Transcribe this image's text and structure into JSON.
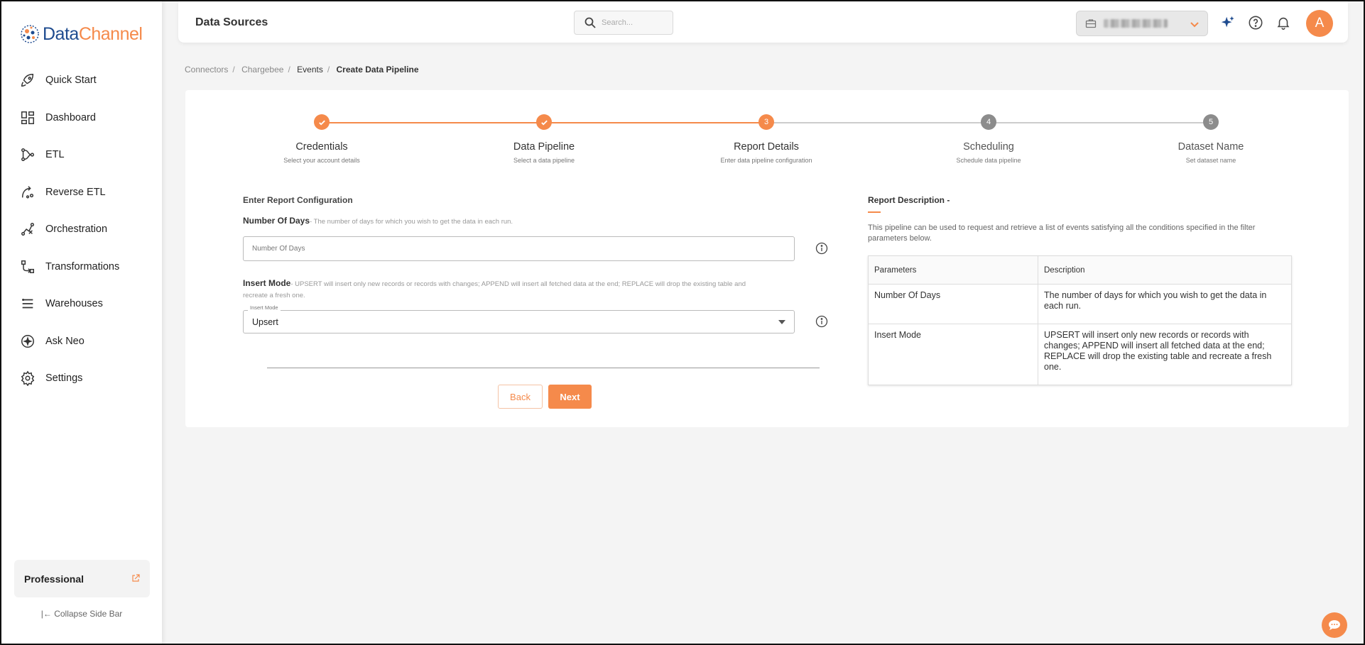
{
  "brand": {
    "name_part1": "Data",
    "name_part2": "Channel"
  },
  "sidebar": {
    "items": [
      {
        "label": "Quick Start",
        "icon": "rocket-icon"
      },
      {
        "label": "Dashboard",
        "icon": "dashboard-icon"
      },
      {
        "label": "ETL",
        "icon": "etl-icon"
      },
      {
        "label": "Reverse ETL",
        "icon": "reverse-etl-icon"
      },
      {
        "label": "Orchestration",
        "icon": "orchestration-icon"
      },
      {
        "label": "Transformations",
        "icon": "transformations-icon"
      },
      {
        "label": "Warehouses",
        "icon": "warehouses-icon"
      },
      {
        "label": "Ask Neo",
        "icon": "ask-neo-icon"
      },
      {
        "label": "Settings",
        "icon": "gear-icon"
      }
    ],
    "plan": "Professional",
    "collapse_label": "Collapse Side Bar"
  },
  "header": {
    "title": "Data Sources",
    "search_placeholder": "Search...",
    "avatar_initial": "A"
  },
  "breadcrumb": [
    "Connectors",
    "Chargebee",
    "Events",
    "Create Data Pipeline"
  ],
  "stepper": [
    {
      "title": "Credentials",
      "subtitle": "Select your account details",
      "state": "done",
      "number": "1"
    },
    {
      "title": "Data Pipeline",
      "subtitle": "Select a data pipeline",
      "state": "done",
      "number": "2"
    },
    {
      "title": "Report Details",
      "subtitle": "Enter data pipeline configuration",
      "state": "active",
      "number": "3"
    },
    {
      "title": "Scheduling",
      "subtitle": "Schedule data pipeline",
      "state": "pending",
      "number": "4"
    },
    {
      "title": "Dataset Name",
      "subtitle": "Set dataset name",
      "state": "pending",
      "number": "5"
    }
  ],
  "form": {
    "heading": "Enter Report Configuration",
    "days_label": "Number Of Days",
    "days_hint": "- The number of days for which you wish to get the data in each run.",
    "days_placeholder": "Number Of Days",
    "days_value": "",
    "mode_label": "Insert Mode",
    "mode_hint": "- UPSERT will insert only new records or records with changes; APPEND will insert all fetched data at the end; REPLACE will drop the existing table and recreate a fresh one.",
    "mode_legend": "Insert Mode",
    "mode_value": "Upsert",
    "back_label": "Back",
    "next_label": "Next"
  },
  "description": {
    "title": "Report Description -",
    "text": "This pipeline can be used to request and retrieve a list of events satisfying all the conditions specified in the filter parameters below.",
    "table_headers": [
      "Parameters",
      "Description"
    ],
    "rows": [
      {
        "param": "Number Of Days",
        "desc": "The number of days for which you wish to get the data in each run."
      },
      {
        "param": "Insert Mode",
        "desc": "UPSERT will insert only new records or records with changes; APPEND will insert all fetched data at the end; REPLACE will drop the existing table and recreate a fresh one."
      }
    ]
  },
  "colors": {
    "accent": "#f58a4b",
    "brand_blue": "#1e4b8f",
    "pending_step": "#8c8c8c"
  }
}
